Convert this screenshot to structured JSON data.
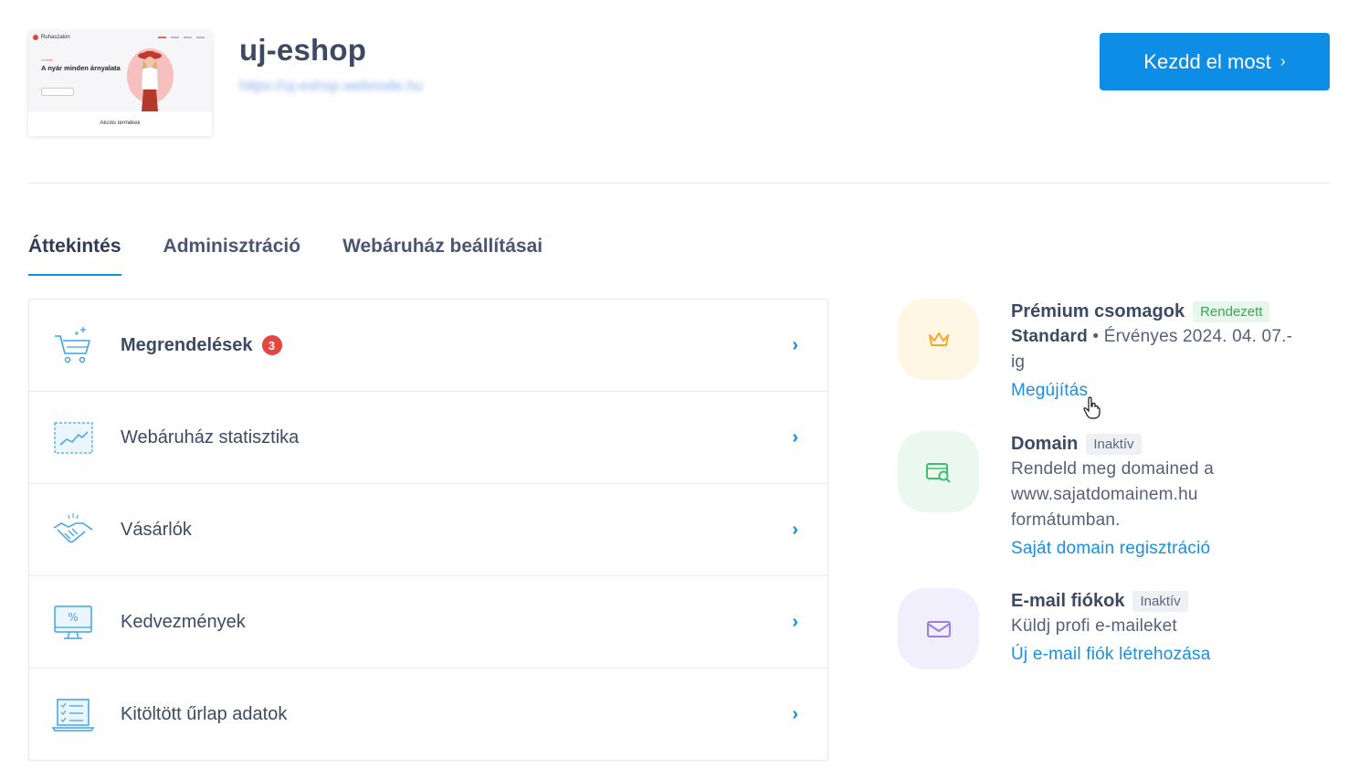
{
  "site": {
    "title": "uj-eshop",
    "url": "https://uj-eshop.webnode.hu",
    "thumbnail": {
      "brand": "Ruhaszalon",
      "tagline": "Limitált",
      "headline": "A nyár minden árnyalata",
      "caption": "Akciós termékek"
    }
  },
  "cta": {
    "label": "Kezdd el most",
    "chevron": "›"
  },
  "tabs": [
    {
      "label": "Áttekintés",
      "active": true
    },
    {
      "label": "Adminisztráció",
      "active": false
    },
    {
      "label": "Webáruház beállításai",
      "active": false
    }
  ],
  "menu": [
    {
      "label": "Megrendelések",
      "badge": "3",
      "icon": "cart-icon"
    },
    {
      "label": "Webáruház statisztika",
      "icon": "chart-icon"
    },
    {
      "label": "Vásárlók",
      "icon": "handshake-icon"
    },
    {
      "label": "Kedvezmények",
      "icon": "discount-monitor-icon"
    },
    {
      "label": "Kitöltött űrlap adatok",
      "icon": "form-laptop-icon"
    }
  ],
  "features": {
    "premium": {
      "title": "Prémium csomagok",
      "tag": "Rendezett",
      "plan": "Standard",
      "validity": " • Érvényes 2024. 04. 07.-ig",
      "link": "Megújítás"
    },
    "domain": {
      "title": "Domain",
      "tag": "Inaktív",
      "desc": "Rendeld meg domained a www.sajatdomainem.hu formátumban.",
      "link": "Saját domain regisztráció"
    },
    "email": {
      "title": "E-mail fiókok",
      "tag": "Inaktív",
      "desc": "Küldj profi e-maileket",
      "link": "Új e-mail fiók létrehozása"
    }
  },
  "colors": {
    "primary": "#0d8de6",
    "badge": "#e5463f",
    "premium_bg": "#fff6e3",
    "domain_bg": "#eaf8ef",
    "email_bg": "#f1effc"
  }
}
